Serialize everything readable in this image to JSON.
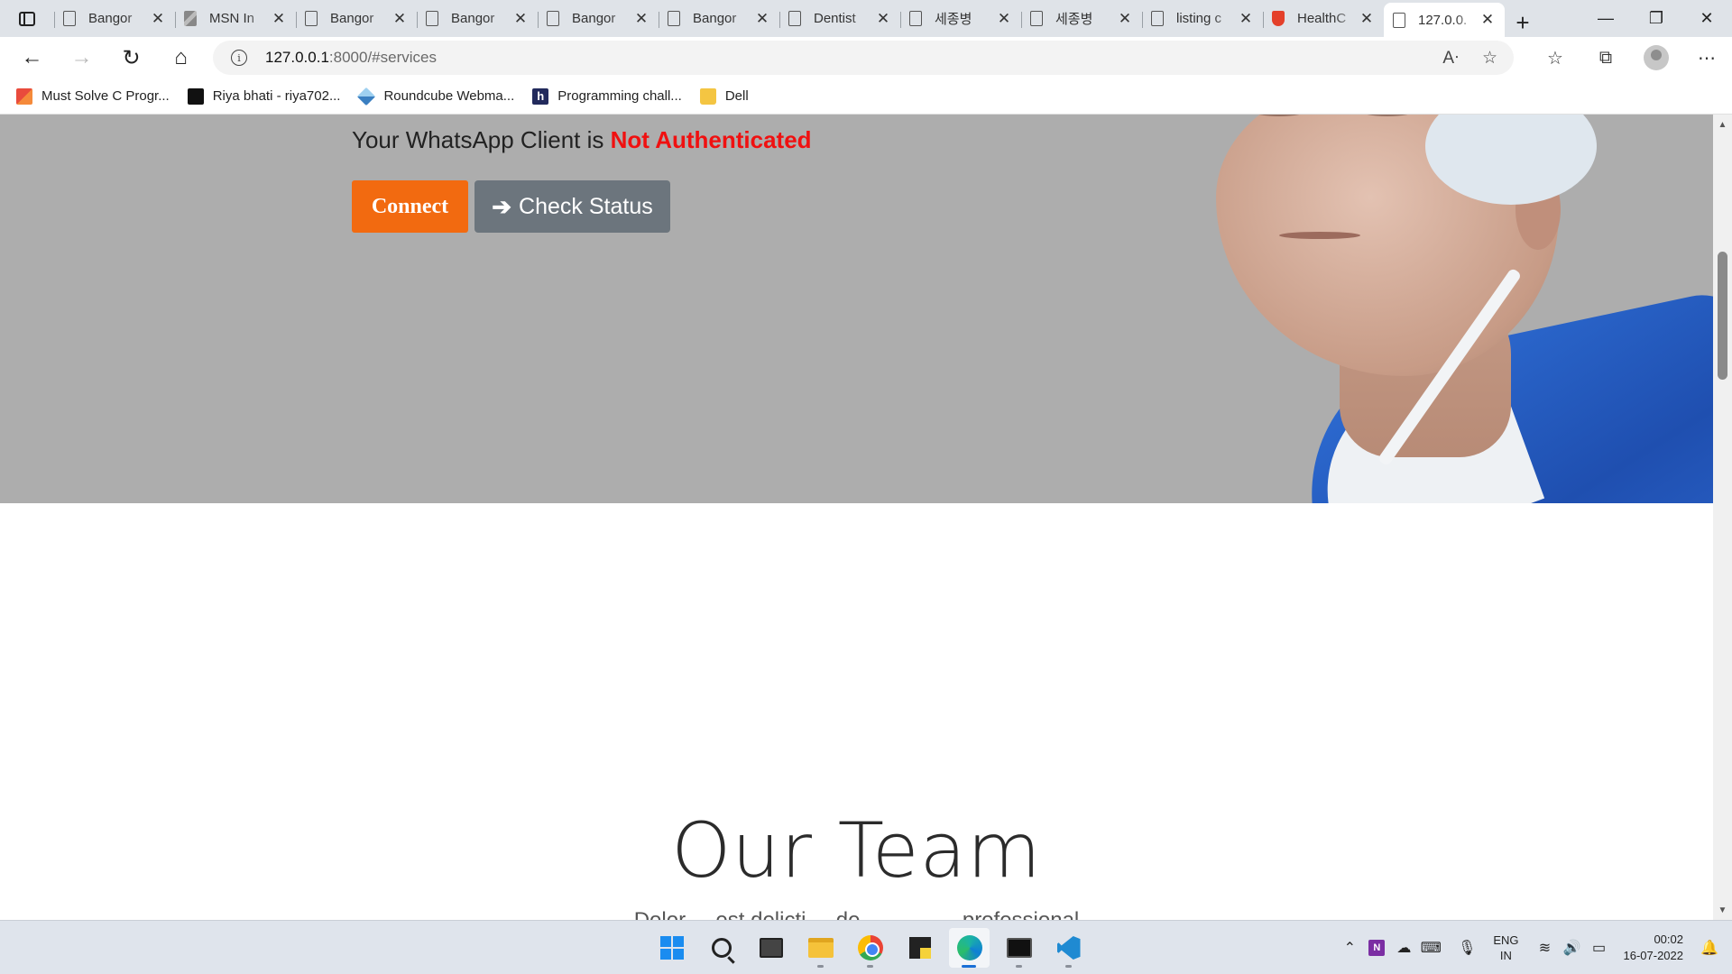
{
  "browser": {
    "tabs": [
      {
        "label": "Bangor",
        "icon": "page-icon"
      },
      {
        "label": "MSN In",
        "icon": "msn-icon"
      },
      {
        "label": "Bangor",
        "icon": "page-icon"
      },
      {
        "label": "Bangor",
        "icon": "page-icon"
      },
      {
        "label": "Bangor",
        "icon": "page-icon"
      },
      {
        "label": "Bangor",
        "icon": "page-icon"
      },
      {
        "label": "Dentist",
        "icon": "page-icon"
      },
      {
        "label": "세종병",
        "icon": "page-icon"
      },
      {
        "label": "세종병",
        "icon": "page-icon"
      },
      {
        "label": "listing c",
        "icon": "page-icon"
      },
      {
        "label": "HealthC",
        "icon": "health-icon"
      },
      {
        "label": "127.0.0.",
        "icon": "page-icon",
        "active": true
      }
    ],
    "close_glyph": "✕",
    "new_tab_glyph": "+",
    "window_controls": {
      "minimize": "—",
      "restore": "❐",
      "close": "✕"
    },
    "url_host": "127.0.0.1",
    "url_rest": ":8000/#services",
    "info_glyph": "i",
    "bookmarks": [
      {
        "label": "Must Solve C Progr...",
        "icon": "red"
      },
      {
        "label": "Riya bhati - riya702...",
        "icon": "dark"
      },
      {
        "label": "Roundcube Webma...",
        "icon": "cube"
      },
      {
        "label": "Programming chall...",
        "icon": "h"
      },
      {
        "label": "Dell",
        "icon": "folder"
      }
    ]
  },
  "page": {
    "status_prefix": "Your WhatsApp Client is",
    "status_value": "Not Authenticated",
    "connect_label": "Connect",
    "check_status_label": "Check Status",
    "team_title": "Our Team",
    "team_subtitle": "Dolor ... est delicti ... de ... ... ... ... professional",
    "colors": {
      "hero_bg": "#adadad",
      "status_bad": "#f01010",
      "connect_bg": "#f26a10",
      "check_bg": "#6c757d"
    }
  },
  "taskbar": {
    "lang_top": "ENG",
    "lang_bottom": "IN",
    "time": "00:02",
    "date": "16-07-2022"
  }
}
